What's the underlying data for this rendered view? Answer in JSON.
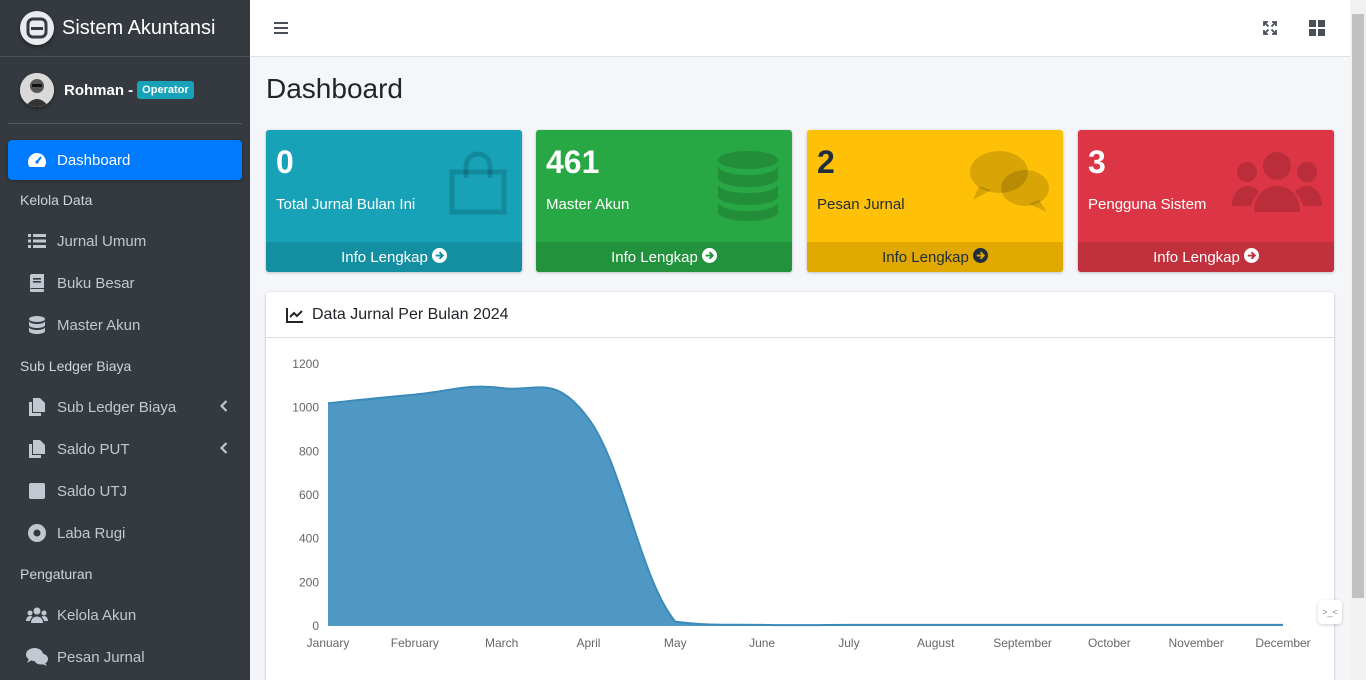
{
  "brand": {
    "title": "Sistem Akuntansi"
  },
  "user": {
    "name": "Rohman -",
    "role": "Operator"
  },
  "sidebar": {
    "items": [
      {
        "type": "item",
        "label": "Dashboard",
        "icon": "tachometer-icon",
        "active": true
      },
      {
        "type": "header",
        "label": "Kelola Data"
      },
      {
        "type": "item",
        "label": "Jurnal Umum",
        "icon": "list-icon"
      },
      {
        "type": "item",
        "label": "Buku Besar",
        "icon": "book-icon"
      },
      {
        "type": "item",
        "label": "Master Akun",
        "icon": "database-icon"
      },
      {
        "type": "header",
        "label": "Sub Ledger Biaya"
      },
      {
        "type": "item",
        "label": "Sub Ledger Biaya",
        "icon": "copy-icon",
        "chevron": true
      },
      {
        "type": "item",
        "label": "Saldo PUT",
        "icon": "copy-icon",
        "chevron": true
      },
      {
        "type": "item",
        "label": "Saldo UTJ",
        "icon": "square-icon"
      },
      {
        "type": "item",
        "label": "Laba Rugi",
        "icon": "circle-dot-icon"
      },
      {
        "type": "header",
        "label": "Pengaturan"
      },
      {
        "type": "item",
        "label": "Kelola Akun",
        "icon": "users-icon"
      },
      {
        "type": "item",
        "label": "Pesan Jurnal",
        "icon": "comments-icon"
      }
    ]
  },
  "page": {
    "title": "Dashboard"
  },
  "boxes": [
    {
      "value": "0",
      "label": "Total Jurnal Bulan Ini",
      "footer": "Info Lengkap",
      "icon": "shopping-bag-icon",
      "color": "#17a2b8"
    },
    {
      "value": "461",
      "label": "Master Akun",
      "footer": "Info Lengkap",
      "icon": "database-icon",
      "color": "#28a745"
    },
    {
      "value": "2",
      "label": "Pesan Jurnal",
      "footer": "Info Lengkap",
      "icon": "comments-icon",
      "color": "#ffc107"
    },
    {
      "value": "3",
      "label": "Pengguna Sistem",
      "footer": "Info Lengkap",
      "icon": "users-icon",
      "color": "#dc3545"
    }
  ],
  "chart_card": {
    "title": "Data Jurnal Per Bulan 2024"
  },
  "chart_data": {
    "type": "area",
    "title": "Data Jurnal Per Bulan 2024",
    "categories": [
      "January",
      "February",
      "March",
      "April",
      "May",
      "June",
      "July",
      "August",
      "September",
      "October",
      "November",
      "December"
    ],
    "series": [
      {
        "values": [
          1020,
          1060,
          1090,
          950,
          20,
          5,
          5,
          5,
          5,
          5,
          5,
          5
        ],
        "color": "#3c8dbc"
      }
    ],
    "ylim": [
      0,
      1200
    ],
    "yticks": [
      0,
      200,
      400,
      600,
      800,
      1000,
      1200
    ],
    "grid": false,
    "xlabel": "",
    "ylabel": ""
  }
}
